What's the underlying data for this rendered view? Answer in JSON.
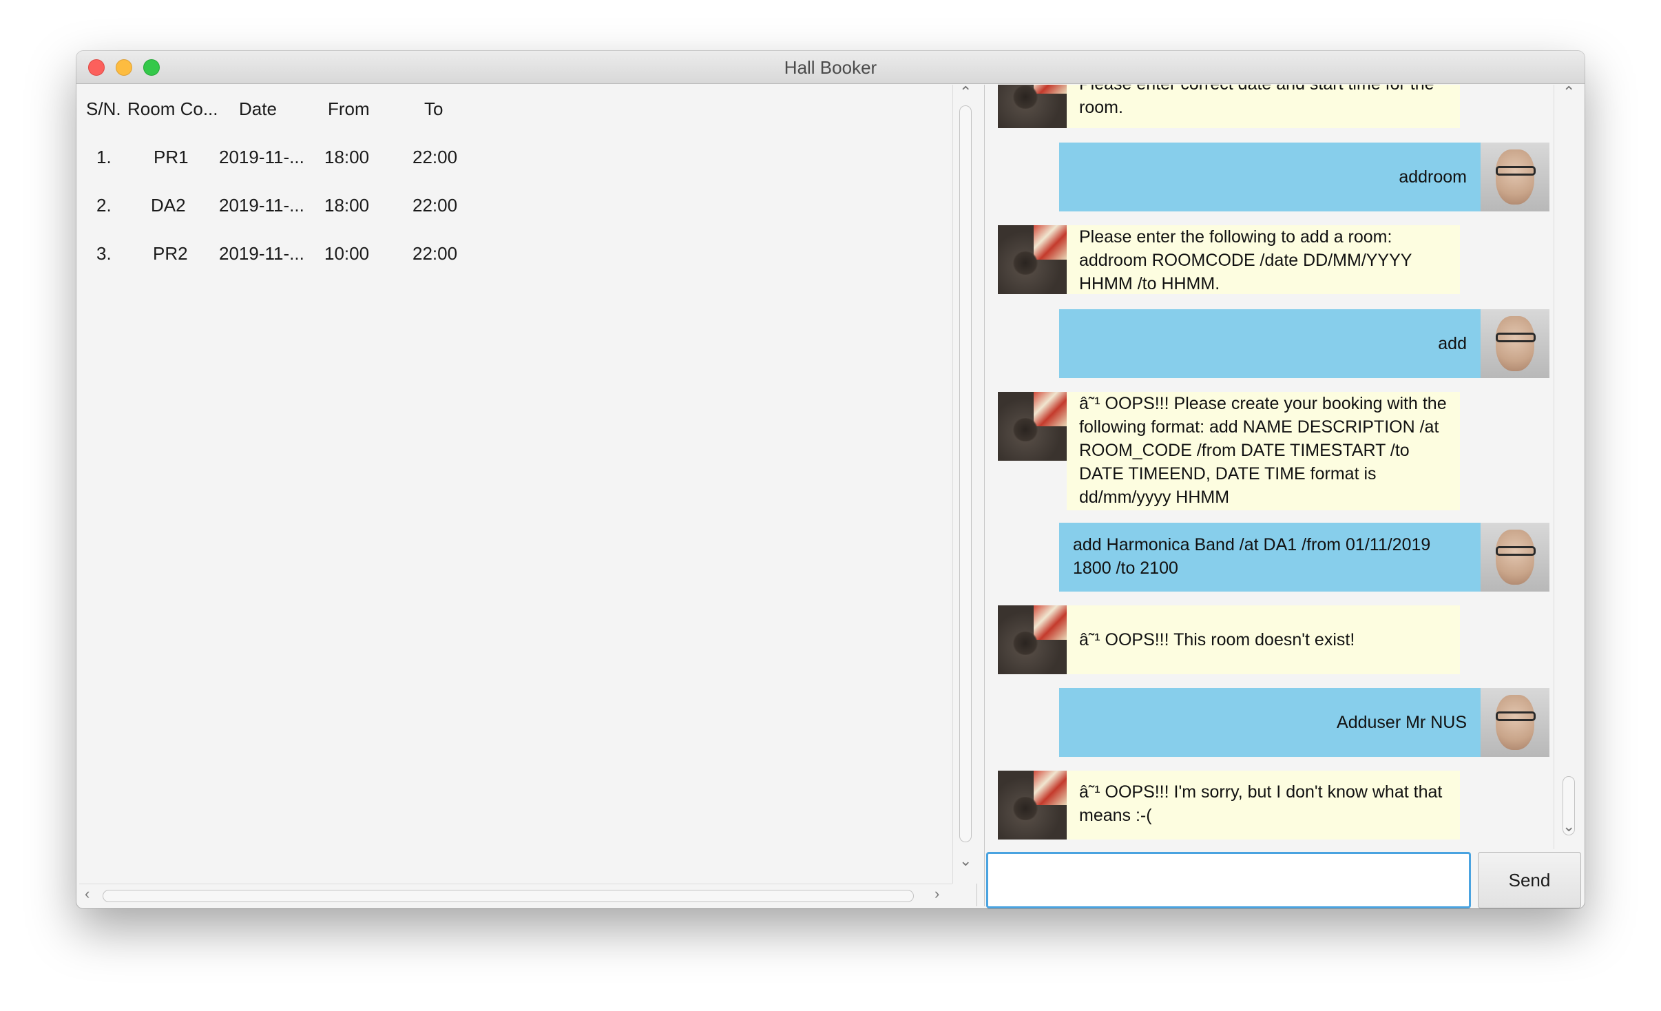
{
  "window": {
    "title": "Hall Booker"
  },
  "table": {
    "headers": [
      "S/N.",
      "Room Co...",
      "Date",
      "From",
      "To"
    ],
    "rows": [
      [
        "1.",
        "PR1",
        "2019-11-...",
        "18:00",
        "22:00"
      ],
      [
        "2.",
        "DA2",
        "2019-11-...",
        "18:00",
        "22:00"
      ],
      [
        "3.",
        "PR2",
        "2019-11-...",
        "10:00",
        "22:00"
      ]
    ]
  },
  "chat": {
    "messages": [
      {
        "from": "duke",
        "text": "Please enter correct date and start time for the room."
      },
      {
        "from": "user",
        "text": "addroom"
      },
      {
        "from": "duke",
        "text": "Please enter the following to add a room: addroom ROOMCODE /date DD/MM/YYYY HHMM /to HHMM."
      },
      {
        "from": "user",
        "text": "add"
      },
      {
        "from": "duke",
        "text": "â˜¹ OOPS!!! Please create your booking with the following format: add NAME DESCRIPTION /at ROOM_CODE /from DATE TIMESTART /to DATE TIMEEND, DATE TIME format is dd/mm/yyyy HHMM"
      },
      {
        "from": "user",
        "text": "add Harmonica Band /at DA1 /from 01/11/2019 1800 /to 2100"
      },
      {
        "from": "duke",
        "text": "â˜¹ OOPS!!! This room doesn't exist!"
      },
      {
        "from": "user",
        "text": "Adduser Mr NUS"
      },
      {
        "from": "duke",
        "text": "â˜¹ OOPS!!! I'm sorry, but I don't know what that means :-("
      }
    ],
    "input": {
      "value": "",
      "placeholder": ""
    },
    "send_label": "Send"
  },
  "icons": {
    "close": "close-traffic-light",
    "minimize": "minimize-traffic-light",
    "zoom": "zoom-traffic-light",
    "scroll_up": "chevron-up-icon",
    "scroll_down": "chevron-down-icon",
    "scroll_left": "chevron-left-icon",
    "scroll_right": "chevron-right-icon"
  },
  "colors": {
    "user_bubble": "#87ceeb",
    "bot_bubble": "#fdfde0",
    "input_focus": "#4aa3e0",
    "close": "#fc605c",
    "minimize": "#fdbc40",
    "zoom": "#34c84a"
  }
}
